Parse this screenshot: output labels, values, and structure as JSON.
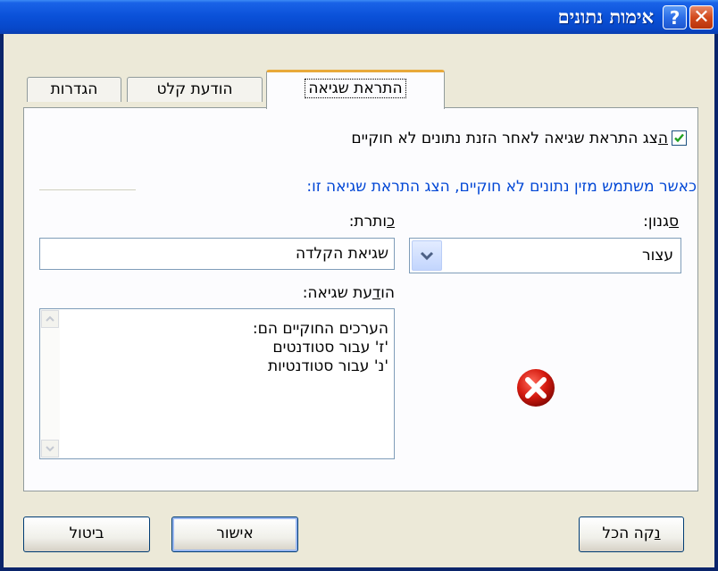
{
  "window": {
    "title": "אימות נתונים",
    "help_label": "?",
    "close_label": "✕"
  },
  "tabs": [
    {
      "label": "הגדרות"
    },
    {
      "label": "הודעת קלט"
    },
    {
      "label": "התראת שגיאה",
      "active": true
    }
  ],
  "panel": {
    "show_error_checkbox": {
      "checked": true,
      "accel": "ה",
      "label_rest": "צג התראת שגיאה לאחר הזנת נתונים לא חוקיים"
    },
    "group_title": "כאשר משתמש מזין נתונים לא חוקיים, הצג התראת שגיאה זו:",
    "style": {
      "accel": "ס",
      "label_rest": "גנון:",
      "value": "עצור"
    },
    "title": {
      "accel": "כ",
      "label_rest": "ותרת:",
      "value": "שגיאת הקלדה"
    },
    "error_message": {
      "label_pre": "הו",
      "accel": "ד",
      "label_post": "עת שגיאה:",
      "lines": [
        "הערכים החוקיים הם:",
        "'ז' עבור סטודנטים",
        "'נ' עבור סטודנטיות"
      ]
    },
    "icon": "error-stop-icon"
  },
  "buttons": {
    "clear_all": {
      "accel": "נ",
      "rest": "קה הכל"
    },
    "ok": "אישור",
    "cancel": "ביטול"
  },
  "colors": {
    "titlebar": "#0a50d8",
    "group_title": "#0046d5",
    "error_icon": "#cc1111",
    "tab_highlight": "#e8a93a"
  }
}
